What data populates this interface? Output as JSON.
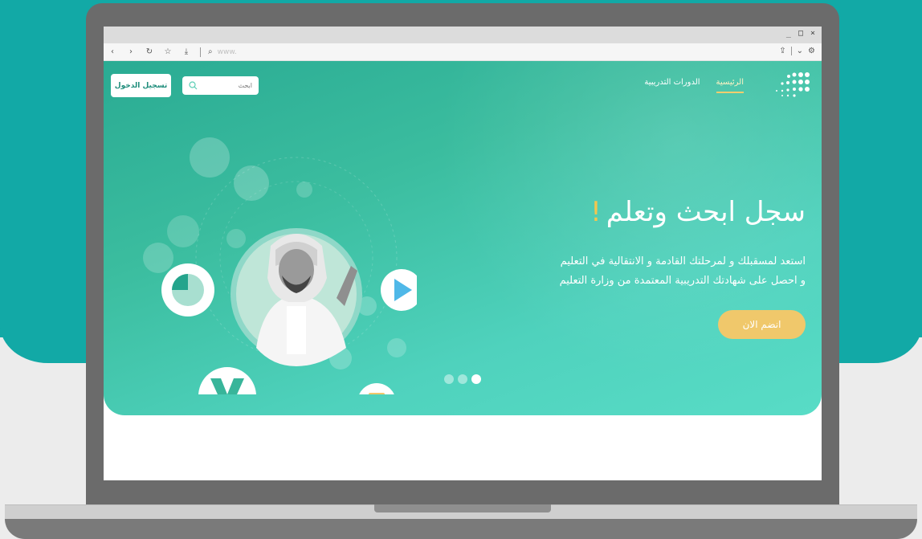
{
  "browser": {
    "url_placeholder": "www.",
    "window_controls": [
      "_",
      "□",
      "×"
    ],
    "nav_icons": [
      "back-icon",
      "forward-icon",
      "reload-icon",
      "star-icon",
      "download-icon",
      "search-icon"
    ]
  },
  "site": {
    "nav": {
      "home": "الرئيسية",
      "courses": "الدورات التدريبية"
    },
    "search": {
      "placeholder": "ابحث"
    },
    "login": "تسجيل الدخول"
  },
  "hero": {
    "title": "سجل ابحث وتعلم",
    "title_mark": "!",
    "line1": "استعد لمسقبلك و لمرحلتك القادمة و الانتقالية في التعليم",
    "line2": "و احصل على شهادتك التدريبية المعتمدة من وزارة التعليم",
    "cta": "انضم الان",
    "slides_total": 3,
    "slide_active": 3
  },
  "colors": {
    "backdrop": "#12a9a6",
    "hero_start": "#2aab93",
    "hero_end": "#58dcc6",
    "accent": "#f0c86b"
  }
}
